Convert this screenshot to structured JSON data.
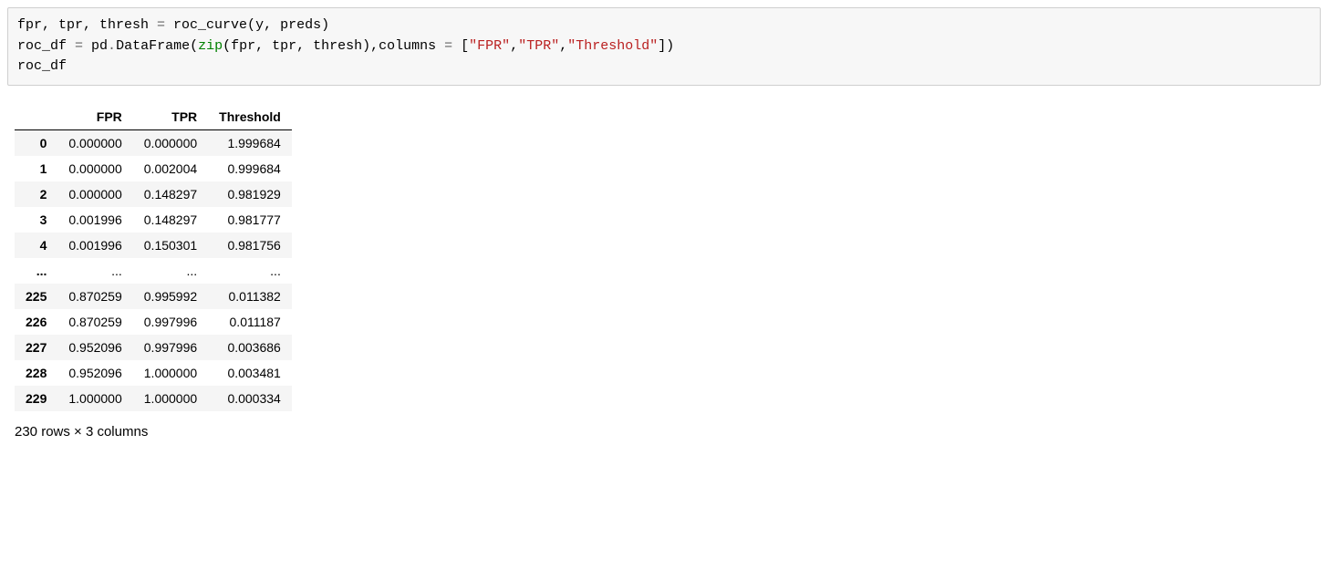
{
  "code": {
    "line1": {
      "p1": "fpr, tpr, thresh ",
      "op1": "=",
      "p2": " roc_curve(y, preds)"
    },
    "line2": {
      "p1": "roc_df ",
      "op1": "=",
      "p2": " pd",
      "dot": ".",
      "p3": "DataFrame(",
      "builtin": "zip",
      "p4": "(fpr, tpr, thresh),columns ",
      "op2": "=",
      "p5": " [",
      "s1": "\"FPR\"",
      "c1": ",",
      "s2": "\"TPR\"",
      "c2": ",",
      "s3": "\"Threshold\"",
      "p6": "])"
    },
    "line3": {
      "p1": "roc_df"
    }
  },
  "table": {
    "columns": [
      "FPR",
      "TPR",
      "Threshold"
    ],
    "rows": [
      {
        "idx": "0",
        "fpr": "0.000000",
        "tpr": "0.000000",
        "thr": "1.999684"
      },
      {
        "idx": "1",
        "fpr": "0.000000",
        "tpr": "0.002004",
        "thr": "0.999684"
      },
      {
        "idx": "2",
        "fpr": "0.000000",
        "tpr": "0.148297",
        "thr": "0.981929"
      },
      {
        "idx": "3",
        "fpr": "0.001996",
        "tpr": "0.148297",
        "thr": "0.981777"
      },
      {
        "idx": "4",
        "fpr": "0.001996",
        "tpr": "0.150301",
        "thr": "0.981756"
      },
      {
        "idx": "...",
        "fpr": "...",
        "tpr": "...",
        "thr": "..."
      },
      {
        "idx": "225",
        "fpr": "0.870259",
        "tpr": "0.995992",
        "thr": "0.011382"
      },
      {
        "idx": "226",
        "fpr": "0.870259",
        "tpr": "0.997996",
        "thr": "0.011187"
      },
      {
        "idx": "227",
        "fpr": "0.952096",
        "tpr": "0.997996",
        "thr": "0.003686"
      },
      {
        "idx": "228",
        "fpr": "0.952096",
        "tpr": "1.000000",
        "thr": "0.003481"
      },
      {
        "idx": "229",
        "fpr": "1.000000",
        "tpr": "1.000000",
        "thr": "0.000334"
      }
    ]
  },
  "shape_info": "230 rows × 3 columns"
}
